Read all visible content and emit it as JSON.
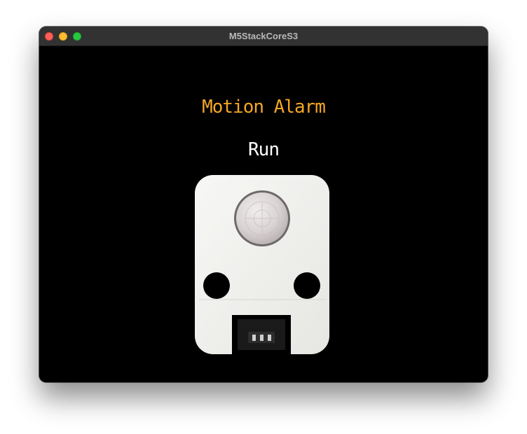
{
  "window": {
    "title": "M5StackCoreS3"
  },
  "screen": {
    "heading": "Motion Alarm",
    "status": "Run",
    "image_icon": "pir-motion-sensor-unit"
  },
  "colors": {
    "background": "#000000",
    "heading": "#f5a623",
    "status": "#ffffff"
  }
}
